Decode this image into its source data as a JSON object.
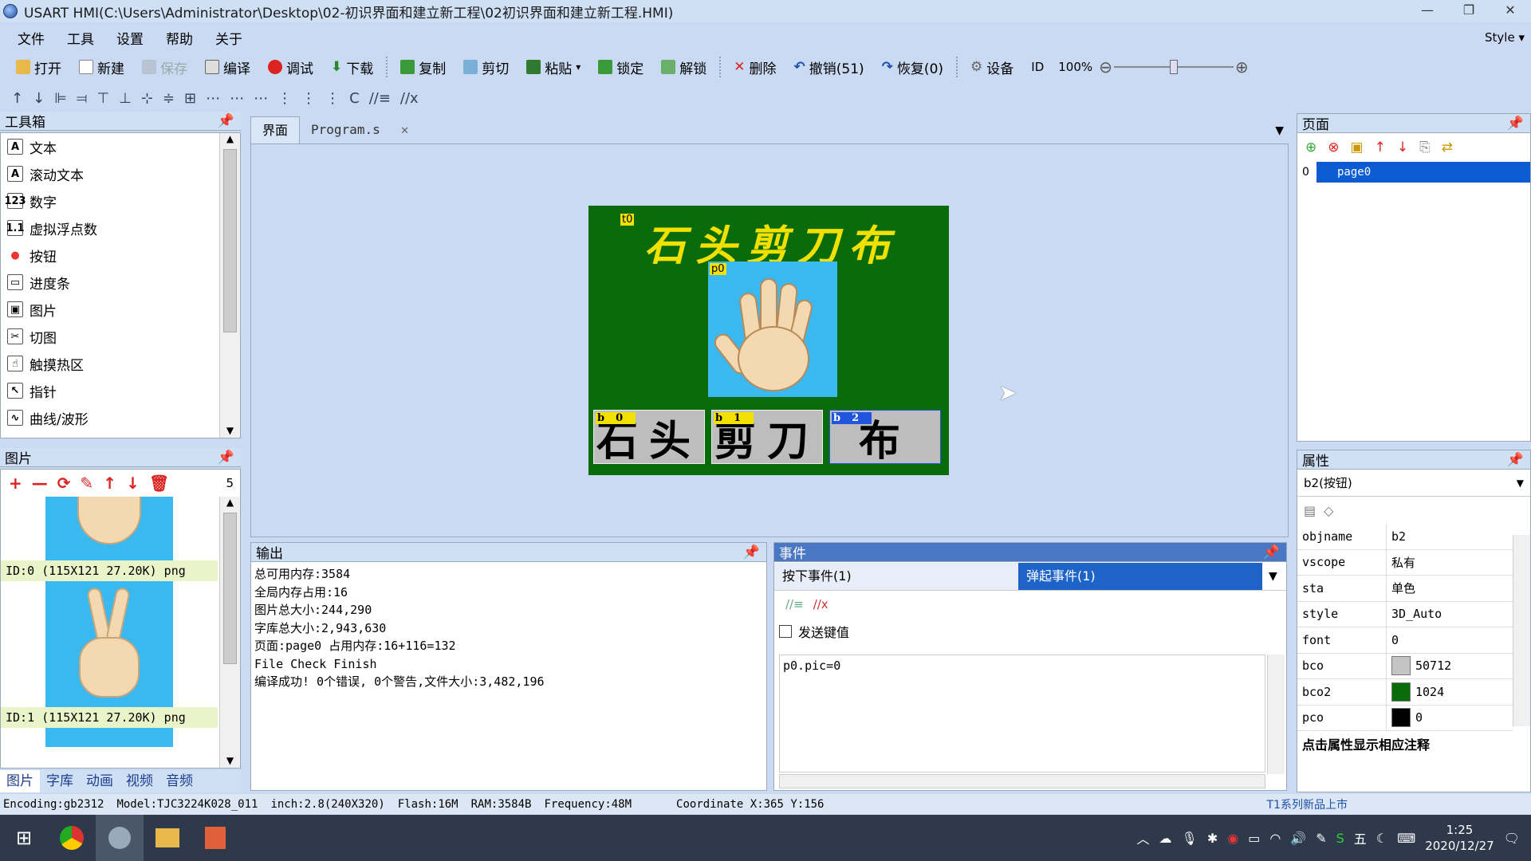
{
  "window": {
    "title": "USART HMI(C:\\Users\\Administrator\\Desktop\\02-初识界面和建立新工程\\02初识界面和建立新工程.HMI)",
    "controls": [
      "—",
      "❐",
      "✕"
    ]
  },
  "menu": {
    "items": [
      "文件",
      "工具",
      "设置",
      "帮助",
      "关于"
    ],
    "style": "Style"
  },
  "toolbar": {
    "open": "打开",
    "new": "新建",
    "save": "保存",
    "compile": "编译",
    "debug": "调试",
    "download": "下载",
    "copy": "复制",
    "cut": "剪切",
    "paste": "粘贴",
    "lock": "锁定",
    "unlock": "解锁",
    "delete": "删除",
    "undo": "撤销(51)",
    "redo": "恢复(0)",
    "device": "设备",
    "id": "ID",
    "zoom": "100%",
    "zoom_level": 0.5
  },
  "align_toolbar": {
    "items": [
      "↑",
      "↓",
      "⊫",
      "⫤",
      "⊤",
      "⊥",
      "⊹",
      "≑",
      "⊞",
      "⋯",
      "⋯",
      "⋯",
      "⋮",
      "⋮",
      "⋮",
      "C",
      "//≡",
      "//x"
    ]
  },
  "toolbox": {
    "title": "工具箱",
    "items": [
      {
        "icon": "A",
        "label": "文本"
      },
      {
        "icon": "A",
        "label": "滚动文本"
      },
      {
        "icon": "123",
        "label": "数字"
      },
      {
        "icon": "1.1",
        "label": "虚拟浮点数"
      },
      {
        "icon": "●",
        "label": "按钮"
      },
      {
        "icon": "▭",
        "label": "进度条"
      },
      {
        "icon": "▣",
        "label": "图片"
      },
      {
        "icon": "✂",
        "label": "切图"
      },
      {
        "icon": "☝",
        "label": "触摸热区"
      },
      {
        "icon": "↖",
        "label": "指针"
      },
      {
        "icon": "∿",
        "label": "曲线/波形"
      }
    ]
  },
  "pictures_panel": {
    "title": "图片",
    "count": "5",
    "items": [
      {
        "label": "ID:0  (115X121 27.20K) png"
      },
      {
        "label": "ID:1  (115X121 27.20K) png"
      }
    ],
    "tabs": [
      "图片",
      "字库",
      "动画",
      "视频",
      "音频"
    ]
  },
  "editor_tabs": [
    {
      "label": "界面"
    },
    {
      "label": "Program.s"
    }
  ],
  "hmi": {
    "title": "石头剪刀布",
    "tags": {
      "t0": "t0",
      "p0": "p0",
      "b0": "b0",
      "b1": "b1",
      "b2": "b2"
    },
    "buttons": [
      "石头",
      "剪刀",
      "布"
    ]
  },
  "output": {
    "title": "输出",
    "lines": [
      "总可用内存:3584",
      "全局内存占用:16",
      "图片总大小:244,290",
      "字库总大小:2,943,630",
      "页面:page0 占用内存:16+116=132",
      "File Check Finish",
      "编译成功! 0个错误, 0个警告,文件大小:3,482,196"
    ]
  },
  "events": {
    "title": "事件",
    "tab_press": "按下事件(1)",
    "tab_release": "弹起事件(1)",
    "send_key_label": "发送键值",
    "code": "p0.pic=0"
  },
  "pages": {
    "title": "页面",
    "items": [
      {
        "index": "0",
        "name": "page0"
      }
    ]
  },
  "properties": {
    "title": "属性",
    "selected": "b2(按钮)",
    "rows": [
      {
        "key": "objname",
        "value": "b2"
      },
      {
        "key": "vscope",
        "value": "私有"
      },
      {
        "key": "sta",
        "value": "单色"
      },
      {
        "key": "style",
        "value": "3D_Auto"
      },
      {
        "key": "font",
        "value": "0"
      },
      {
        "key": "bco",
        "value": "50712",
        "color": "#c4c4c4"
      },
      {
        "key": "bco2",
        "value": "1024",
        "color": "#0a6b0a"
      },
      {
        "key": "pco",
        "value": "0",
        "color": "#000000"
      }
    ],
    "hint": "点击属性显示相应注释"
  },
  "status": {
    "encoding": "Encoding:gb2312",
    "model": "Model:TJC3224K028_011",
    "inch": "inch:2.8(240X320)",
    "flash": "Flash:16M",
    "ram": "RAM:3584B",
    "freq": "Frequency:48M",
    "coord": "Coordinate X:365  Y:156",
    "promo": "T1系列新品上市"
  },
  "tray": {
    "ime": "五",
    "time": "1:25",
    "date": "2020/12/27"
  },
  "colors": {
    "hmi_bg": "#0a6b0a",
    "title_yellow": "#f2e000",
    "hand_bg": "#3ab8f0",
    "selected_blue": "#0b5bd3"
  }
}
